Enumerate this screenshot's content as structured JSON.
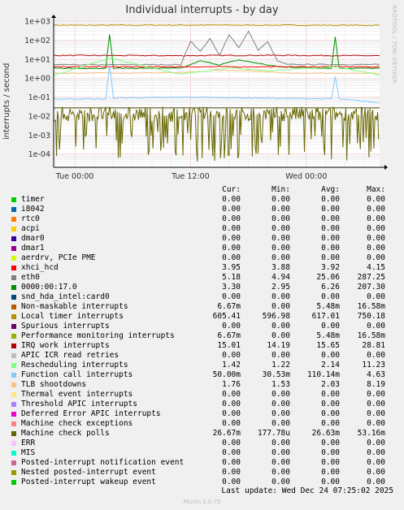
{
  "title": "Individual interrupts - by day",
  "side_credit": "RRDTOOL / TOBI OETIKER",
  "footer": "Munin 2.0.75",
  "last_update": "Last update: Wed Dec 24 07:25:02 2025",
  "columns": [
    "Cur:",
    "Min:",
    "Avg:",
    "Max:"
  ],
  "legend": [
    {
      "name": "timer",
      "color": "#00cc00",
      "cur": "0.00",
      "min": "0.00",
      "avg": "0.00",
      "max": "0.00"
    },
    {
      "name": "i8042",
      "color": "#0066b3",
      "cur": "0.00",
      "min": "0.00",
      "avg": "0.00",
      "max": "0.00"
    },
    {
      "name": "rtc0",
      "color": "#ff8000",
      "cur": "0.00",
      "min": "0.00",
      "avg": "0.00",
      "max": "0.00"
    },
    {
      "name": "acpi",
      "color": "#ffcc00",
      "cur": "0.00",
      "min": "0.00",
      "avg": "0.00",
      "max": "0.00"
    },
    {
      "name": "dmar0",
      "color": "#330099",
      "cur": "0.00",
      "min": "0.00",
      "avg": "0.00",
      "max": "0.00"
    },
    {
      "name": "dmar1",
      "color": "#990099",
      "cur": "0.00",
      "min": "0.00",
      "avg": "0.00",
      "max": "0.00"
    },
    {
      "name": "aerdrv, PCIe PME",
      "color": "#ccff00",
      "cur": "0.00",
      "min": "0.00",
      "avg": "0.00",
      "max": "0.00"
    },
    {
      "name": "xhci_hcd",
      "color": "#ff0000",
      "cur": "3.95",
      "min": "3.88",
      "avg": "3.92",
      "max": "4.15"
    },
    {
      "name": "eth0",
      "color": "#808080",
      "cur": "5.18",
      "min": "4.94",
      "avg": "25.06",
      "max": "287.25"
    },
    {
      "name": "0000:00:17.0",
      "color": "#008f00",
      "cur": "3.30",
      "min": "2.95",
      "avg": "6.26",
      "max": "207.30"
    },
    {
      "name": "snd_hda_intel:card0",
      "color": "#00487d",
      "cur": "0.00",
      "min": "0.00",
      "avg": "0.00",
      "max": "0.00"
    },
    {
      "name": "Non-maskable interrupts",
      "color": "#b35a00",
      "cur": "6.67m",
      "min": "0.00",
      "avg": "5.48m",
      "max": "16.58m"
    },
    {
      "name": "Local timer interrupts",
      "color": "#b38f00",
      "cur": "605.41",
      "min": "596.98",
      "avg": "617.01",
      "max": "750.18"
    },
    {
      "name": "Spurious interrupts",
      "color": "#6b006b",
      "cur": "0.00",
      "min": "0.00",
      "avg": "0.00",
      "max": "0.00"
    },
    {
      "name": "Performance monitoring interrupts",
      "color": "#8fb300",
      "cur": "6.67m",
      "min": "0.00",
      "avg": "5.48m",
      "max": "16.58m"
    },
    {
      "name": "IRQ work interrupts",
      "color": "#b30000",
      "cur": "15.01",
      "min": "14.19",
      "avg": "15.65",
      "max": "28.81"
    },
    {
      "name": "APIC ICR read retries",
      "color": "#bebebe",
      "cur": "0.00",
      "min": "0.00",
      "avg": "0.00",
      "max": "0.00"
    },
    {
      "name": "Rescheduling interrupts",
      "color": "#80ff80",
      "cur": "1.42",
      "min": "1.22",
      "avg": "2.14",
      "max": "11.23"
    },
    {
      "name": "Function call interrupts",
      "color": "#80c9ff",
      "cur": "50.00m",
      "min": "30.53m",
      "avg": "110.14m",
      "max": "4.63"
    },
    {
      "name": "TLB shootdowns",
      "color": "#ffc080",
      "cur": "1.76",
      "min": "1.53",
      "avg": "2.03",
      "max": "8.19"
    },
    {
      "name": "Thermal event interrupts",
      "color": "#ffe680",
      "cur": "0.00",
      "min": "0.00",
      "avg": "0.00",
      "max": "0.00"
    },
    {
      "name": "Threshold APIC interrupts",
      "color": "#aa80ff",
      "cur": "0.00",
      "min": "0.00",
      "avg": "0.00",
      "max": "0.00"
    },
    {
      "name": "Deferred Error APIC interrupts",
      "color": "#ee00cc",
      "cur": "0.00",
      "min": "0.00",
      "avg": "0.00",
      "max": "0.00"
    },
    {
      "name": "Machine check exceptions",
      "color": "#ff8080",
      "cur": "0.00",
      "min": "0.00",
      "avg": "0.00",
      "max": "0.00"
    },
    {
      "name": "Machine check polls",
      "color": "#666600",
      "cur": "26.67m",
      "min": "177.78u",
      "avg": "26.63m",
      "max": "53.16m"
    },
    {
      "name": "ERR",
      "color": "#ffbfff",
      "cur": "0.00",
      "min": "0.00",
      "avg": "0.00",
      "max": "0.00"
    },
    {
      "name": "MIS",
      "color": "#00ffcc",
      "cur": "0.00",
      "min": "0.00",
      "avg": "0.00",
      "max": "0.00"
    },
    {
      "name": "Posted-interrupt notification event",
      "color": "#cc6699",
      "cur": "0.00",
      "min": "0.00",
      "avg": "0.00",
      "max": "0.00"
    },
    {
      "name": "Nested posted-interrupt event",
      "color": "#999900",
      "cur": "0.00",
      "min": "0.00",
      "avg": "0.00",
      "max": "0.00"
    },
    {
      "name": "Posted-interrupt wakeup event",
      "color": "#00cc00",
      "cur": "0.00",
      "min": "0.00",
      "avg": "0.00",
      "max": "0.00"
    }
  ],
  "chart_data": {
    "type": "line",
    "title": "Individual interrupts - by day",
    "ylabel": "interrupts / second",
    "yscale": "log",
    "ylim": [
      2e-05,
      1000
    ],
    "y_tick_labels": [
      "1e+03",
      "1e+02",
      "1e+01",
      "1e+00",
      "1e-01",
      "1e-02",
      "1e-03",
      "1e-04"
    ],
    "y_tick_values": [
      1000,
      100,
      10,
      1,
      0.1,
      0.01,
      0.001,
      0.0001
    ],
    "x_tick_labels": [
      "Tue 00:00",
      "Tue 12:00",
      "Wed 00:00"
    ],
    "x_tick_hours": [
      0,
      12,
      24
    ],
    "xlim_hours": [
      -2.2,
      31.6
    ],
    "grid": true,
    "series": [
      {
        "name": "Local timer interrupts",
        "color": "#b38f00",
        "x": [
          -2.2,
          0,
          12,
          24,
          31.6
        ],
        "y": [
          617,
          605,
          620,
          610,
          605.41
        ]
      },
      {
        "name": "IRQ work interrupts",
        "color": "#b30000",
        "x": [
          -2.2,
          10,
          20,
          31.6
        ],
        "y": [
          15.6,
          15.1,
          15.8,
          15.01
        ]
      },
      {
        "name": "eth0",
        "color": "#808080",
        "x": [
          -2.2,
          11,
          12,
          13,
          14,
          15,
          16,
          17,
          18,
          19,
          20,
          21,
          22,
          31.6
        ],
        "y": [
          5.0,
          5.1,
          90,
          25,
          120,
          15,
          200,
          40,
          287.25,
          30,
          80,
          8,
          5.2,
          5.18
        ]
      },
      {
        "name": "0000:00:17.0",
        "color": "#008f00",
        "x": [
          -2.2,
          3.2,
          3.6,
          4.0,
          11,
          13,
          15,
          17,
          19,
          21,
          26.6,
          27.0,
          27.4,
          31.6
        ],
        "y": [
          3.3,
          3.3,
          207.3,
          3.3,
          3.3,
          8,
          5,
          9,
          6,
          4,
          3.3,
          150,
          3.3,
          3.3
        ]
      },
      {
        "name": "xhci_hcd",
        "color": "#ff0000",
        "x": [
          -2.2,
          31.6
        ],
        "y": [
          3.92,
          3.95
        ]
      },
      {
        "name": "TLB shootdowns",
        "color": "#ffc080",
        "x": [
          -2.2,
          11,
          15,
          20,
          22,
          31.6
        ],
        "y": [
          1.8,
          1.9,
          2.6,
          2.2,
          1.8,
          1.76
        ]
      },
      {
        "name": "Rescheduling interrupts",
        "color": "#80ff80",
        "x": [
          -2.2,
          3.6,
          11,
          16,
          20,
          27.0,
          31.6
        ],
        "y": [
          1.4,
          11.23,
          1.6,
          3.5,
          2.4,
          4.0,
          1.42
        ]
      },
      {
        "name": "Function call interrupts",
        "color": "#80c9ff",
        "x": [
          -2.2,
          3.2,
          3.6,
          4.0,
          12,
          26.6,
          27.0,
          27.4,
          31.6
        ],
        "y": [
          0.08,
          0.08,
          4.63,
          0.09,
          0.1,
          0.08,
          1.2,
          0.08,
          0.05
        ]
      },
      {
        "name": "Machine check polls",
        "color": "#666600",
        "x": [
          -2.2,
          31.6
        ],
        "y": [
          0.0267,
          0.0267
        ]
      }
    ]
  }
}
